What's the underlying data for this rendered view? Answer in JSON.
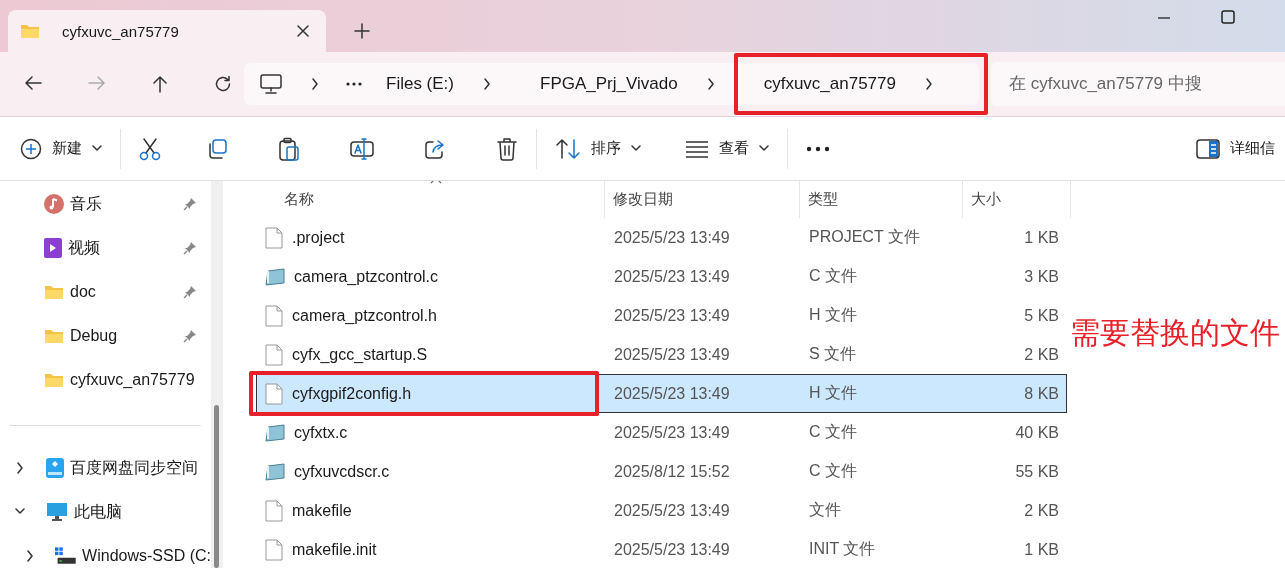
{
  "tabs": [
    {
      "label": "cyfxuvc_an75779",
      "selected": true
    }
  ],
  "address_bar": {
    "breadcrumbs": [
      {
        "label": "Files (E:)",
        "marked": false
      },
      {
        "label": "FPGA_Prj_Vivado",
        "marked": false
      },
      {
        "label": "cyfxuvc_an75779",
        "marked": true
      }
    ]
  },
  "search": {
    "placeholder": "在 cyfxuvc_an75779 中搜"
  },
  "toolbar": [
    {
      "kind": "new",
      "label": "新建"
    },
    {
      "kind": "cut"
    },
    {
      "kind": "copy"
    },
    {
      "kind": "paste"
    },
    {
      "kind": "rename"
    },
    {
      "kind": "share"
    },
    {
      "kind": "delete"
    },
    {
      "kind": "sort",
      "label": "排序"
    },
    {
      "kind": "view",
      "label": "查看"
    },
    {
      "kind": "more"
    },
    {
      "kind": "details",
      "label": "详细信"
    }
  ],
  "sidebar": {
    "quick_access": [
      {
        "label": "音乐",
        "kind": "music",
        "pinned": true
      },
      {
        "label": "视频",
        "kind": "video",
        "pinned": true
      },
      {
        "label": "doc",
        "kind": "folder",
        "pinned": true
      },
      {
        "label": "Debug",
        "kind": "folder",
        "pinned": true
      },
      {
        "label": "cyfxuvc_an75779",
        "kind": "folder",
        "pinned": false
      }
    ],
    "tree": [
      {
        "label": "百度网盘同步空间",
        "kind": "cloud",
        "expanded": false
      },
      {
        "label": "此电脑",
        "kind": "pc",
        "expanded": true,
        "children": [
          {
            "label": "Windows-SSD (C:",
            "kind": "drive",
            "expanded": false
          }
        ]
      }
    ]
  },
  "table": {
    "columns": [
      {
        "label": "名称",
        "sorted": true
      },
      {
        "label": "修改日期",
        "sorted": false
      },
      {
        "label": "类型",
        "sorted": false
      },
      {
        "label": "大小",
        "sorted": false
      }
    ],
    "rows": [
      {
        "name": ".project",
        "modified": "2025/5/23 13:49",
        "type": "PROJECT 文件",
        "size": "1 KB",
        "kind": "file",
        "selected": false,
        "marked": false
      },
      {
        "name": "camera_ptzcontrol.c",
        "modified": "2025/5/23 13:49",
        "type": "C 文件",
        "size": "3 KB",
        "kind": "source",
        "selected": false,
        "marked": false
      },
      {
        "name": "camera_ptzcontrol.h",
        "modified": "2025/5/23 13:49",
        "type": "H 文件",
        "size": "5 KB",
        "kind": "file",
        "selected": false,
        "marked": false
      },
      {
        "name": "cyfx_gcc_startup.S",
        "modified": "2025/5/23 13:49",
        "type": "S 文件",
        "size": "2 KB",
        "kind": "file",
        "selected": false,
        "marked": false
      },
      {
        "name": "cyfxgpif2config.h",
        "modified": "2025/5/23 13:49",
        "type": "H 文件",
        "size": "8 KB",
        "kind": "file",
        "selected": true,
        "marked": true
      },
      {
        "name": "cyfxtx.c",
        "modified": "2025/5/23 13:49",
        "type": "C 文件",
        "size": "40 KB",
        "kind": "source",
        "selected": false,
        "marked": false
      },
      {
        "name": "cyfxuvcdscr.c",
        "modified": "2025/8/12 15:52",
        "type": "C 文件",
        "size": "55 KB",
        "kind": "source",
        "selected": false,
        "marked": false
      },
      {
        "name": "makefile",
        "modified": "2025/5/23 13:49",
        "type": "文件",
        "size": "2 KB",
        "kind": "file",
        "selected": false,
        "marked": false
      },
      {
        "name": "makefile.init",
        "modified": "2025/5/23 13:49",
        "type": "INIT 文件",
        "size": "1 KB",
        "kind": "file",
        "selected": false,
        "marked": false
      }
    ]
  },
  "annotation": {
    "note": "需要替换的文件"
  }
}
